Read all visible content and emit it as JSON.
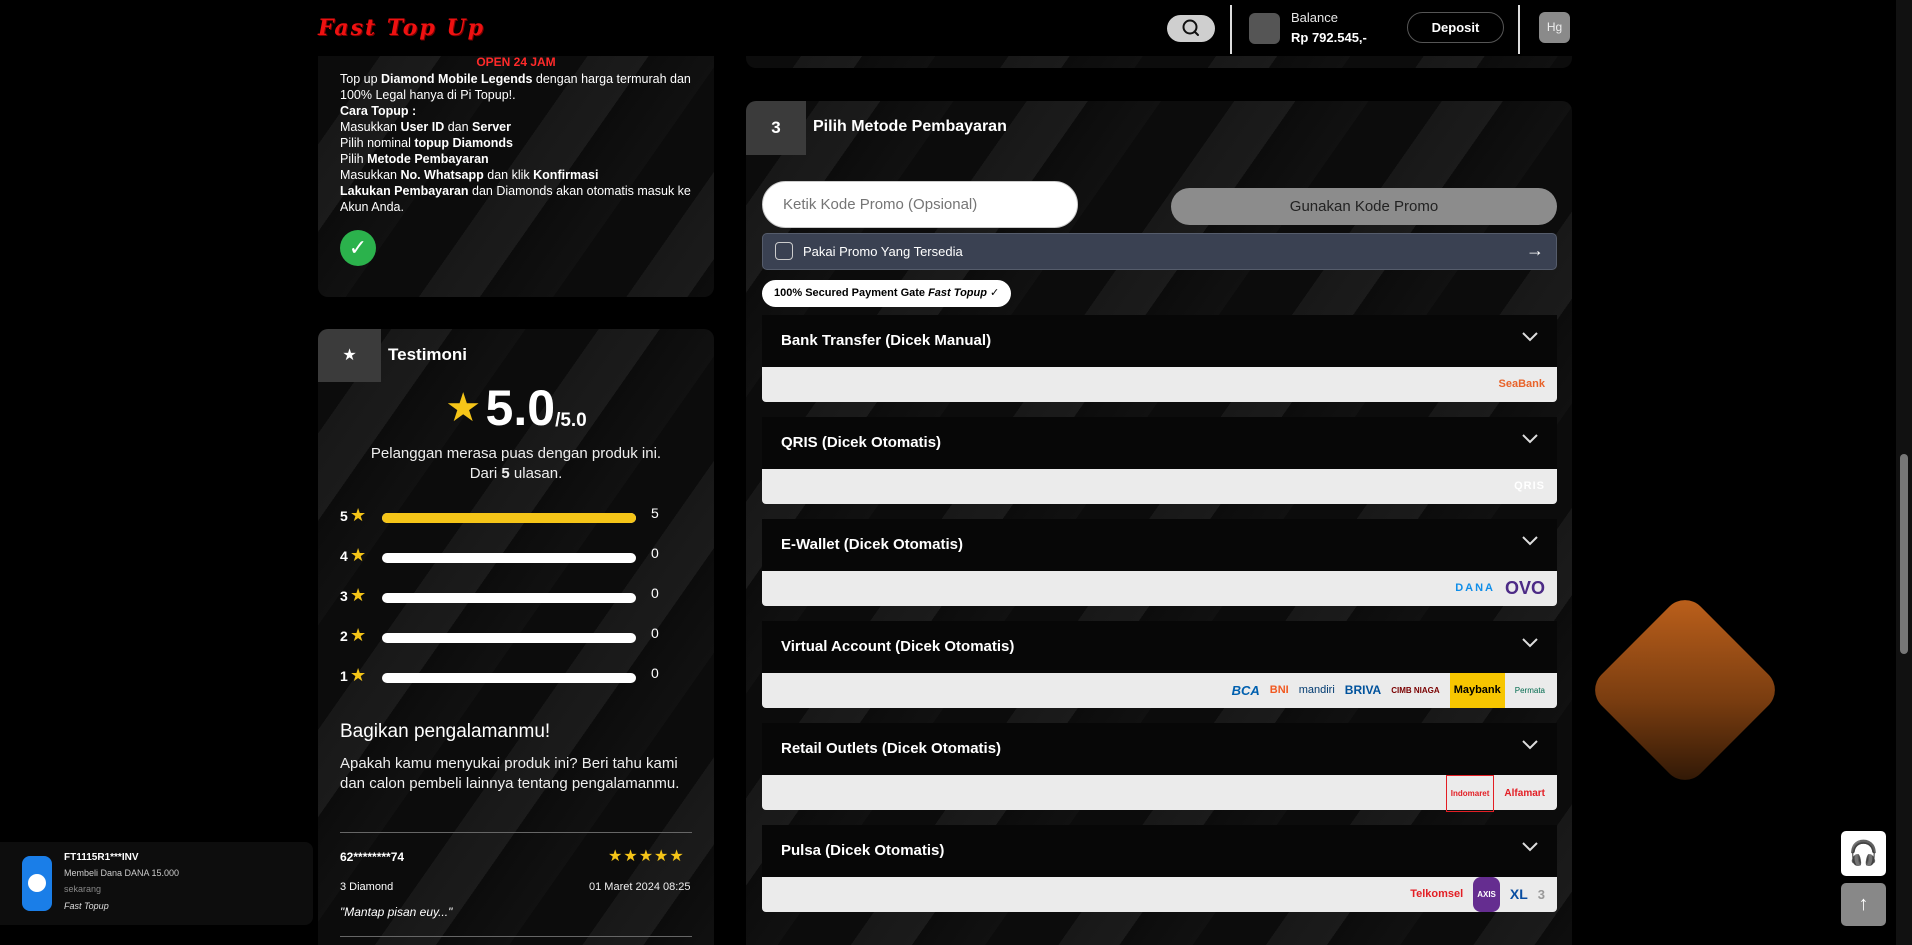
{
  "header": {
    "logo_text": "Fast Top Up",
    "balance_label": "Balance",
    "balance_value": "Rp 792.545,-",
    "deposit_label": "Deposit",
    "user_initials": "Hg"
  },
  "info": {
    "open_label": "OPEN 24 JAM",
    "line1_pre": "Top up ",
    "line1_bold": "Diamond Mobile Legends",
    "line1_post": " dengan harga termurah dan 100% Legal hanya di Pi Topup!.",
    "howto_title": "Cara Topup :",
    "step1_pre": "Masukkan ",
    "step1_b1": "User ID",
    "step1_mid": " dan ",
    "step1_b2": "Server",
    "step2_pre": "Pilih nominal ",
    "step2_b": "topup Diamonds",
    "step3_pre": "Pilih ",
    "step3_b": "Metode Pembayaran",
    "step4_pre": "Masukkan ",
    "step4_b1": "No. Whatsapp",
    "step4_mid": " dan klik ",
    "step4_b2": "Konfirmasi",
    "step5_b": "Lakukan Pembayaran",
    "step5_post": " dan Diamonds akan otomatis masuk ke Akun Anda."
  },
  "testimoni": {
    "title": "Testimoni",
    "rating": "5.0",
    "rating_max": "/5.0",
    "satisfied_line1": "Pelanggan merasa puas dengan produk ini.",
    "satisfied_pre": "Dari ",
    "satisfied_count": "5",
    "satisfied_post": " ulasan.",
    "distribution": [
      {
        "star": "5",
        "count": "5",
        "fraction": 1.0
      },
      {
        "star": "4",
        "count": "0",
        "fraction": 0
      },
      {
        "star": "3",
        "count": "0",
        "fraction": 0
      },
      {
        "star": "2",
        "count": "0",
        "fraction": 0
      },
      {
        "star": "1",
        "count": "0",
        "fraction": 0
      }
    ],
    "share_title": "Bagikan pengalamanmu!",
    "share_desc": "Apakah kamu menyukai produk ini? Beri tahu kami dan calon pembeli lainnya tentang pengalamanmu.",
    "review": {
      "user": "62********74",
      "stars": "★★★★★",
      "rating_value": 5,
      "item": "3 Diamond",
      "date": "01 Maret 2024 08:25",
      "text": "\"Mantap pisan euy...\""
    }
  },
  "payment": {
    "step_number": "3",
    "step_title": "Pilih Metode Pembayaran",
    "promo_placeholder": "Ketik Kode Promo (Opsional)",
    "promo_button": "Gunakan Kode Promo",
    "available_promo": "Pakai Promo Yang Tersedia",
    "secure_pre": "100% Secured Payment Gate ",
    "secure_brand": "Fast Topup",
    "methods": [
      {
        "name": "Bank Transfer (Dicek Manual)",
        "logos": [
          "SeaBank"
        ]
      },
      {
        "name": "QRIS (Dicek Otomatis)",
        "logos": [
          "QRIS"
        ]
      },
      {
        "name": "E-Wallet (Dicek Otomatis)",
        "logos": [
          "DANA",
          "OVO"
        ]
      },
      {
        "name": "Virtual Account (Dicek Otomatis)",
        "logos": [
          "BCA",
          "BNI",
          "mandiri",
          "BRIVA",
          "CIMB NIAGA",
          "Maybank",
          "Permata"
        ]
      },
      {
        "name": "Retail Outlets (Dicek Otomatis)",
        "logos": [
          "Indomaret",
          "Alfamart"
        ]
      },
      {
        "name": "Pulsa (Dicek Otomatis)",
        "logos": [
          "Telkomsel",
          "AXIS",
          "XL",
          "3"
        ]
      }
    ]
  },
  "toast": {
    "invoice": "FT1115R1***INV",
    "desc": "Membeli Dana DANA 15.000",
    "time": "sekarang",
    "brand": "Fast Topup"
  },
  "icons": {
    "search": "search-icon",
    "check": "check-icon",
    "star": "star-icon",
    "chevron": "chevron-down-icon",
    "arrow_right": "arrow-right-icon",
    "arrow_up": "arrow-up-icon",
    "chat": "chat-support-icon"
  },
  "colors": {
    "accent_star": "#f5c518",
    "open_red": "#ff2a2a",
    "logo_red": "#ee1111",
    "check_green": "#2bb24c",
    "promo_bar": "#3a4152"
  }
}
